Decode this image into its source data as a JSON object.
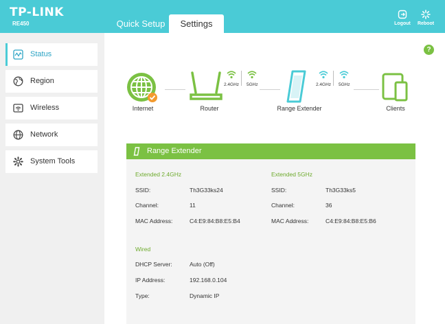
{
  "brand": {
    "logo": "TP-LINK",
    "model": "RE450"
  },
  "tabs": [
    {
      "label": "Quick Setup",
      "active": false
    },
    {
      "label": "Settings",
      "active": true
    }
  ],
  "header_buttons": {
    "logout": "Logout",
    "reboot": "Reboot"
  },
  "sidebar": {
    "items": [
      {
        "label": "Status",
        "icon": "status-icon",
        "active": true
      },
      {
        "label": "Region",
        "icon": "region-icon",
        "active": false
      },
      {
        "label": "Wireless",
        "icon": "wireless-icon",
        "active": false
      },
      {
        "label": "Network",
        "icon": "network-icon",
        "active": false
      },
      {
        "label": "System Tools",
        "icon": "system-tools-icon",
        "active": false
      }
    ]
  },
  "help": "?",
  "topology": {
    "internet": "Internet",
    "router": "Router",
    "range_extender": "Range Extender",
    "clients": "Clients",
    "band_24": "2.4GHz",
    "band_5": "5GHz"
  },
  "panel": {
    "title": "Range Extender",
    "extended_24": {
      "title": "Extended 2.4GHz",
      "rows": [
        {
          "key": "SSID:",
          "value": "Th3G33ks24"
        },
        {
          "key": "Channel:",
          "value": "11"
        },
        {
          "key": "MAC Address:",
          "value": "C4:E9:84:B8:E5:B4"
        }
      ]
    },
    "extended_5": {
      "title": "Extended 5GHz",
      "rows": [
        {
          "key": "SSID:",
          "value": "Th3G33ks5"
        },
        {
          "key": "Channel:",
          "value": "36"
        },
        {
          "key": "MAC Address:",
          "value": "C4:E9:84:B8:E5:B6"
        }
      ]
    },
    "wired": {
      "title": "Wired",
      "rows": [
        {
          "key": "DHCP Server:",
          "value": "Auto (Off)"
        },
        {
          "key": "IP Address:",
          "value": "192.168.0.104"
        },
        {
          "key": "Type:",
          "value": "Dynamic IP"
        }
      ]
    }
  },
  "colors": {
    "header": "#4acbd6",
    "accent_green": "#7bc143",
    "active_text": "#2ba3c4",
    "orange": "#f39a2e"
  }
}
